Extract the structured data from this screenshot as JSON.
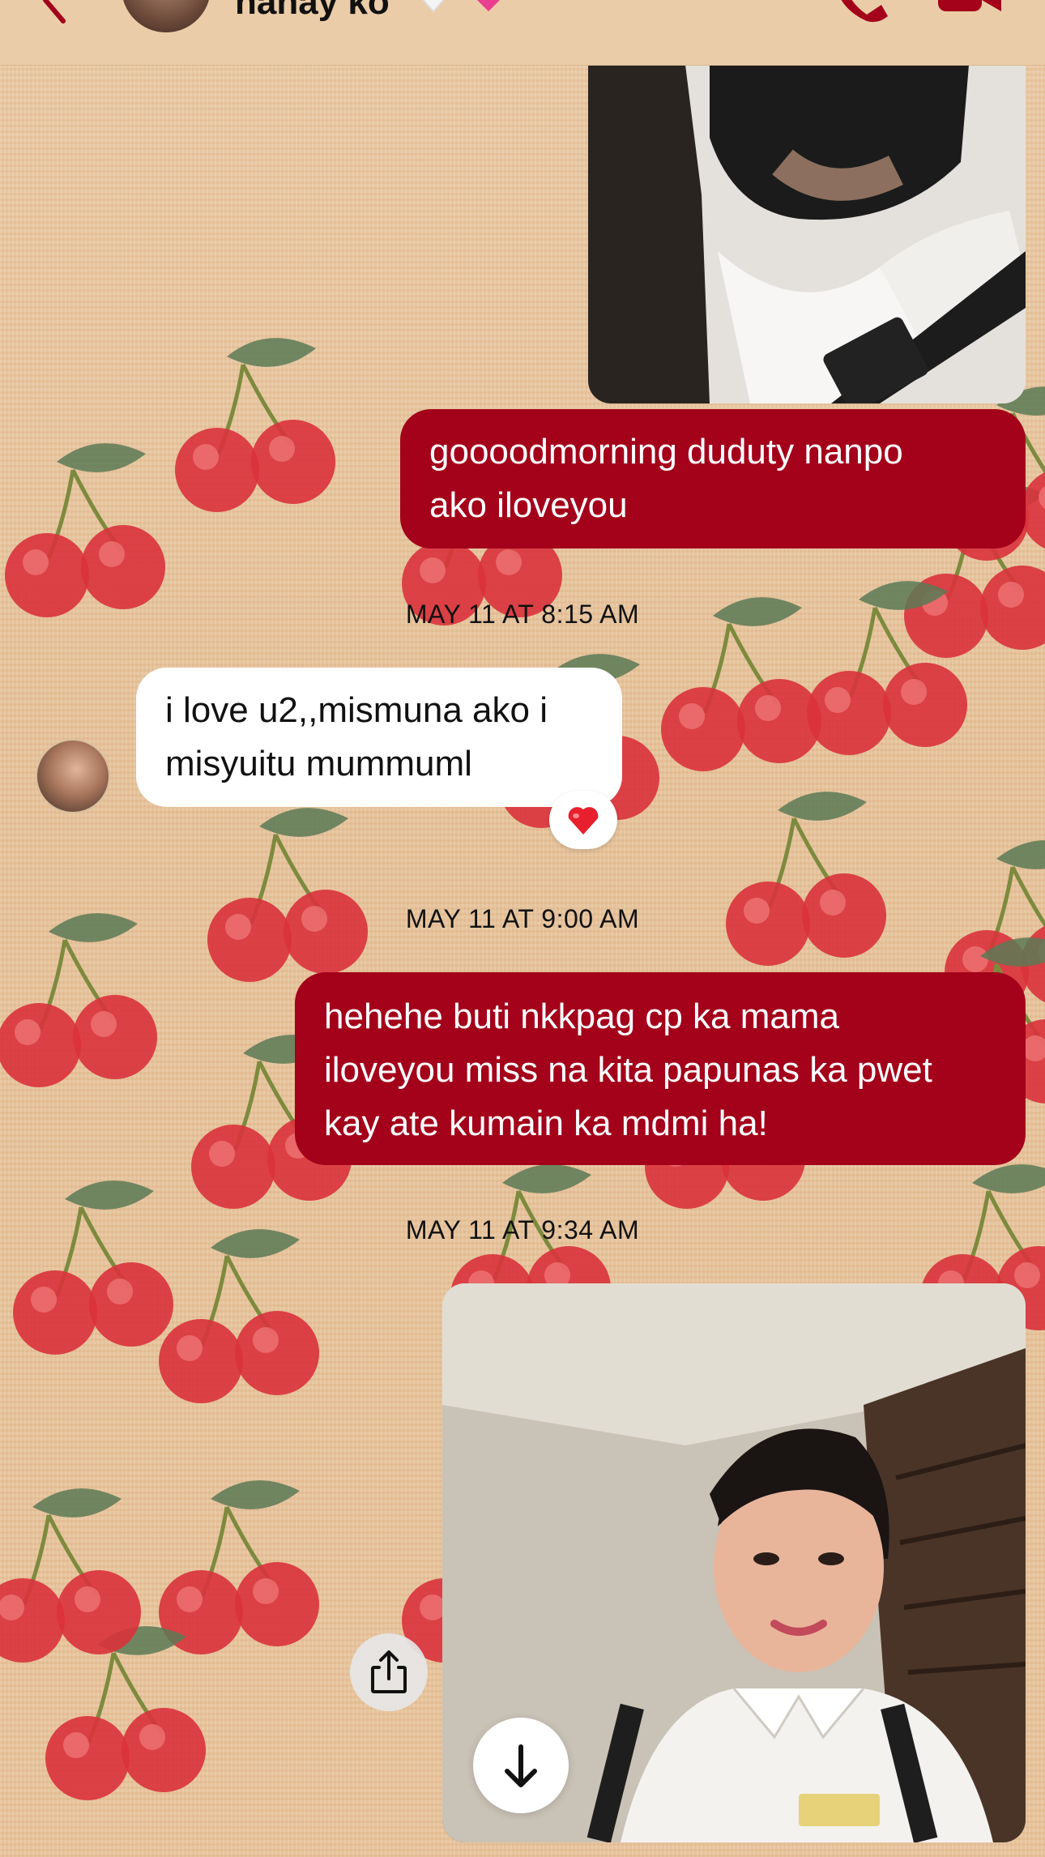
{
  "header": {
    "contact_name": "nanay ko",
    "back_icon": "chevron-left-icon",
    "phone_icon": "phone-icon",
    "video_icon": "video-camera-icon",
    "emoji_1": "white-heart",
    "emoji_2": "pink-heart",
    "accent_color": "#a3021a"
  },
  "messages": [
    {
      "type": "image",
      "direction": "sent",
      "description": "photo"
    },
    {
      "type": "text",
      "direction": "sent",
      "lines": [
        "goooodmorning duduty nanpo",
        "ako iloveyou"
      ]
    },
    {
      "type": "timestamp",
      "text": "MAY 11 AT 8:15 AM"
    },
    {
      "type": "text",
      "direction": "received",
      "lines": [
        "i love u2,,mismuna ako i",
        "misyuitu mummuml"
      ],
      "reaction": "❤️"
    },
    {
      "type": "timestamp",
      "text": "MAY 11 AT 9:00 AM"
    },
    {
      "type": "text",
      "direction": "sent",
      "lines": [
        "hehehe buti nkkpag cp ka mama",
        "iloveyou miss na kita papunas ka pwet",
        "kay ate kumain ka mdmi ha!"
      ]
    },
    {
      "type": "timestamp",
      "text": "MAY 11 AT 9:34 AM"
    },
    {
      "type": "image",
      "direction": "sent",
      "description": "photo"
    }
  ],
  "controls": {
    "share_icon": "share-icon",
    "scroll_down_icon": "arrow-down-icon"
  },
  "colors": {
    "sent_bubble": "#a3021a",
    "received_bubble": "#ffffff",
    "background": "#e9c9a2"
  }
}
